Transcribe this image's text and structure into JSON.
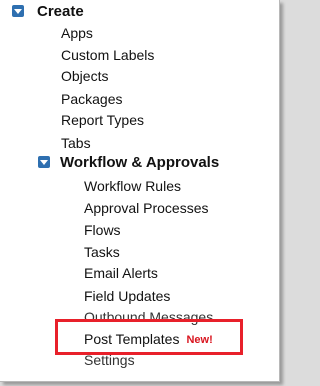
{
  "create": {
    "label": "Create",
    "items": [
      "Apps",
      "Custom Labels",
      "Objects",
      "Packages",
      "Report Types",
      "Tabs"
    ]
  },
  "workflow": {
    "label": "Workflow & Approvals",
    "items": [
      "Workflow Rules",
      "Approval Processes",
      "Flows",
      "Tasks",
      "Email Alerts",
      "Field Updates",
      "Outbound Messages",
      "Post Templates",
      "Settings"
    ],
    "new_badge": "New!"
  },
  "colors": {
    "toggle": "#2e6fb0",
    "highlight_border": "#e8202a",
    "new_badge": "#d9141e"
  },
  "icons": [
    "expand-toggle-icon"
  ]
}
